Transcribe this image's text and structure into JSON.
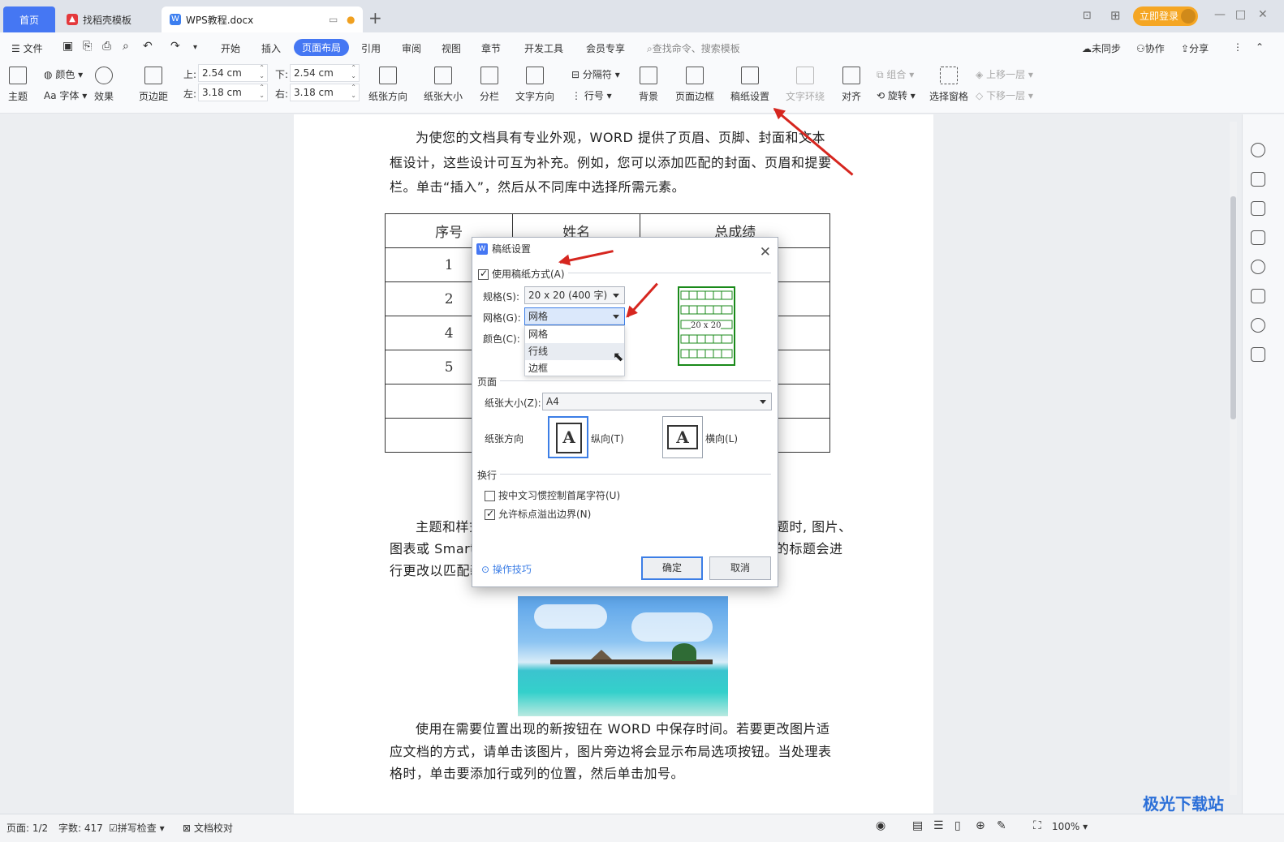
{
  "tabs": {
    "home": "首页",
    "template": "找稻壳模板",
    "doc": "WPS教程.docx"
  },
  "title_actions": {
    "login": "立即登录"
  },
  "menu": {
    "file": "文件",
    "items": [
      "开始",
      "插入",
      "页面布局",
      "引用",
      "审阅",
      "视图",
      "章节",
      "开发工具",
      "会员专享"
    ],
    "active": "页面布局",
    "search": "查找命令、搜索模板",
    "sync": "未同步",
    "collab": "协作",
    "share": "分享"
  },
  "ribbon": {
    "theme": "主题",
    "color": "颜色",
    "font": "Aa 字体",
    "effect": "效果",
    "margin": "页边距",
    "margins": {
      "top_label": "上:",
      "top": "2.54 cm",
      "bottom_label": "下:",
      "bottom": "2.54 cm",
      "left_label": "左:",
      "left": "3.18 cm",
      "right_label": "右:",
      "right": "3.18 cm"
    },
    "orientation": "纸张方向",
    "size": "纸张大小",
    "columns": "分栏",
    "text_dir": "文字方向",
    "separator": "分隔符",
    "line_no": "行号",
    "background": "背景",
    "page_border": "页面边框",
    "manuscript": "稿纸设置",
    "wrap": "文字环绕",
    "align": "对齐",
    "group": "组合",
    "rotate": "旋转",
    "selection_pane": "选择窗格",
    "bring_forward": "上移一层",
    "send_backward": "下移一层"
  },
  "document": {
    "para1": "为使您的文档具有专业外观，WORD 提供了页眉、页脚、封面和文本框设计，这些设计可互为补充。例如，您可以添加匹配的封面、页眉和提要栏。单击“插入”，然后从不同库中选择所需元素。",
    "table_headers": [
      "序号",
      "姓名",
      "总成绩"
    ],
    "table_rows": [
      [
        "1",
        "",
        ""
      ],
      [
        "2",
        "",
        ""
      ],
      [
        "4",
        "",
        ""
      ],
      [
        "5",
        "",
        ""
      ],
      [
        "",
        "",
        ""
      ],
      [
        "",
        "",
        ""
      ]
    ],
    "para2_line1_left": "主题和样式",
    "para2_line1_right": "题时, 图片、",
    "para2_line2_left": "图表或 Smart/",
    "para2_line2_right": "的标题会进",
    "para2_line3_left": "行更改以匹配新",
    "para3": "使用在需要位置出现的新按钮在 WORD 中保存时间。若要更改图片适应文档的方式，请单击该图片，图片旁边将会显示布局选项按钮。当处理表格时，单击要添加行或列的位置，然后单击加号。"
  },
  "dialog": {
    "title": "稿纸设置",
    "use_manuscript": "使用稿纸方式(A)",
    "spec_label": "规格(S):",
    "spec_value": "20 x 20 (400 字)",
    "grid_label": "网格(G):",
    "grid_value": "网格",
    "color_label": "颜色(C):",
    "grid_options": [
      "网格",
      "行线",
      "边框"
    ],
    "preview_label": "20 x 20",
    "page_section": "页面",
    "paper_size_label": "纸张大小(Z):",
    "paper_size_value": "A4",
    "orientation_label": "纸张方向",
    "portrait": "纵向(T)",
    "landscape": "横向(L)",
    "wrap_section": "换行",
    "opt1": "按中文习惯控制首尾字符(U)",
    "opt2": "允许标点溢出边界(N)",
    "tips": "操作技巧",
    "ok": "确定",
    "cancel": "取消"
  },
  "status": {
    "page": "页面: 1/2",
    "words": "字数: 417",
    "spell": "拼写检查",
    "proof": "文档校对",
    "zoom": "100%"
  },
  "watermark": "极光下载站"
}
